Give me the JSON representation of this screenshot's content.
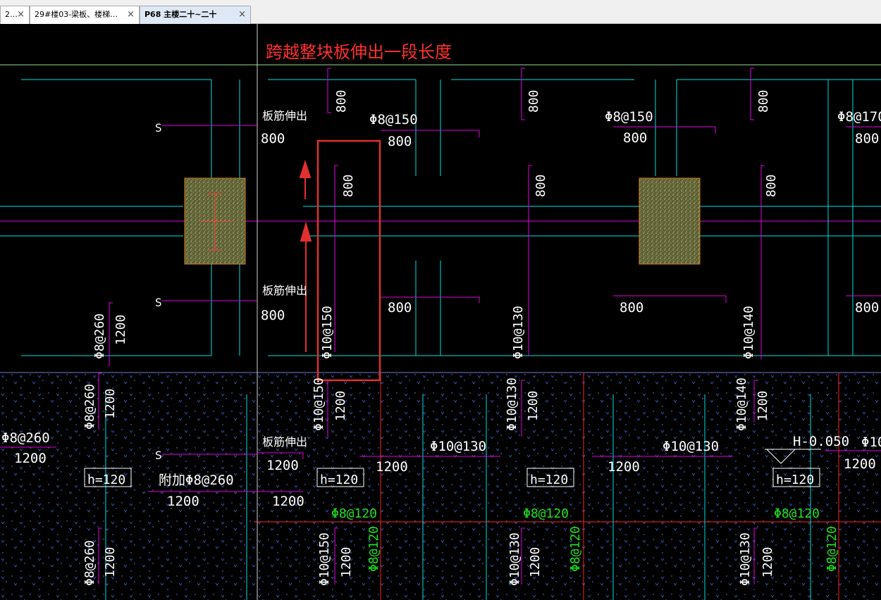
{
  "tabs": [
    {
      "label": "2…",
      "close": "×",
      "active": false
    },
    {
      "label": "29#楼03-梁板、楼梯…",
      "close": "×",
      "active": false
    },
    {
      "label": "P68 主楼二十~二十",
      "close": "×",
      "active": true
    }
  ],
  "annotation": {
    "title": "跨越整块板伸出一段长度"
  },
  "rebar_labels": {
    "phi8_150": "Φ8@150",
    "phi8_170": "Φ8@170",
    "phi8_260": "Φ8@260",
    "phi8_120": "Φ8@120",
    "phi10_150": "Φ10@150",
    "phi10_130": "Φ10@130",
    "phi10_140": "Φ10@140",
    "add_phi8_260": "附加Φ8@260",
    "phi10_trunc": "Φ10"
  },
  "text_labels": {
    "n800": "800",
    "n1200": "1200",
    "slab_ext": "板筋伸出",
    "s": "S",
    "h120": "h=120",
    "elev": "H-0.050"
  },
  "colors": {
    "background": "#000000",
    "cyan": "#00e0e0",
    "magenta": "#e000e0",
    "red": "#ff2020",
    "green": "#20e020",
    "white": "#ffffff",
    "highlight_box": "#e03030",
    "column_fill": "#6b6a3e",
    "column_border": "#d08020",
    "hatch": "#3a4fa0",
    "grid_green": "#90e090"
  }
}
